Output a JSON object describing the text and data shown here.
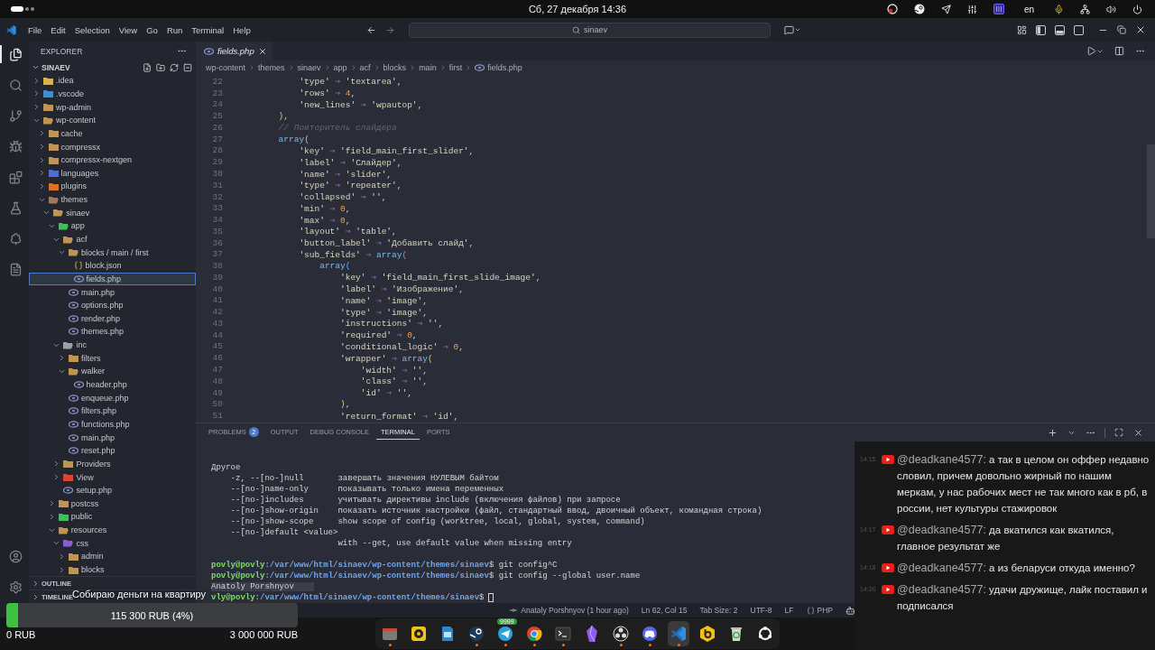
{
  "top_bar": {
    "date": "Сб, 27 декабря 14:36",
    "keyboard_layout": "en"
  },
  "title_bar": {
    "menu": [
      "File",
      "Edit",
      "Selection",
      "View",
      "Go",
      "Run",
      "Terminal",
      "Help"
    ],
    "command_center": "sinaev",
    "layout_toggles": [
      {
        "on": true
      },
      {
        "on": true
      },
      {
        "on": false
      }
    ]
  },
  "activity_bar": [
    {
      "selected": true
    },
    {
      "selected": false
    },
    {
      "selected": false
    },
    {
      "selected": false
    },
    {
      "selected": false
    },
    {
      "selected": false
    },
    {
      "selected": false
    },
    {
      "selected": false
    }
  ],
  "explorer": {
    "title": "EXPLORER",
    "root": {
      "label": "SINAEV",
      "expanded": true
    },
    "tree": [
      {
        "label": ".idea",
        "kind": "folder",
        "color": "#d8b24a",
        "expanded": false,
        "selected": false
      },
      {
        "label": ".vscode",
        "kind": "folder",
        "color": "#3d8fd1",
        "expanded": false,
        "selected": false
      },
      {
        "label": "wp-admin",
        "kind": "folder",
        "color": "#c09553",
        "expanded": false,
        "selected": false
      },
      {
        "label": "wp-content",
        "kind": "folder",
        "color": "#c09553",
        "expanded": true,
        "selected": false,
        "children": [
          {
            "label": "cache",
            "kind": "folder",
            "color": "#c09553",
            "expanded": false,
            "selected": false
          },
          {
            "label": "compressx",
            "kind": "folder",
            "color": "#c09553",
            "expanded": false,
            "selected": false
          },
          {
            "label": "compressx-nextgen",
            "kind": "folder",
            "color": "#c09553",
            "expanded": false,
            "selected": false
          },
          {
            "label": "languages",
            "kind": "folder",
            "color": "#4a6fd6",
            "expanded": false,
            "selected": false
          },
          {
            "label": "plugins",
            "kind": "folder",
            "color": "#e0701f",
            "expanded": false,
            "selected": false
          },
          {
            "label": "themes",
            "kind": "folder",
            "color": "#a0785a",
            "expanded": true,
            "selected": false,
            "children": [
              {
                "label": "sinaev",
                "kind": "folder",
                "color": "#c09553",
                "expanded": true,
                "selected": false,
                "children": [
                  {
                    "label": "app",
                    "kind": "folder",
                    "color": "#3dbf5a",
                    "expanded": true,
                    "selected": false,
                    "children": [
                      {
                        "label": "acf",
                        "kind": "folder",
                        "color": "#c09553",
                        "expanded": true,
                        "selected": false,
                        "children": [
                          {
                            "label": "blocks / main / first",
                            "kind": "folder",
                            "color": "#c09553",
                            "expanded": true,
                            "selected": false,
                            "children": [
                              {
                                "label": "block.json",
                                "kind": "json-file",
                                "selected": false
                              },
                              {
                                "label": "fields.php",
                                "kind": "php-file",
                                "selected": true
                              }
                            ]
                          },
                          {
                            "label": "main.php",
                            "kind": "php-file",
                            "selected": false
                          },
                          {
                            "label": "options.php",
                            "kind": "php-file",
                            "selected": false
                          },
                          {
                            "label": "render.php",
                            "kind": "php-file",
                            "selected": false
                          },
                          {
                            "label": "themes.php",
                            "kind": "php-file",
                            "selected": false
                          }
                        ]
                      },
                      {
                        "label": "inc",
                        "kind": "folder",
                        "color": "#9aa0a6",
                        "expanded": true,
                        "selected": false,
                        "children": [
                          {
                            "label": "filters",
                            "kind": "folder",
                            "color": "#c09553",
                            "expanded": false,
                            "selected": false
                          },
                          {
                            "label": "walker",
                            "kind": "folder",
                            "color": "#c09553",
                            "expanded": true,
                            "selected": false,
                            "children": [
                              {
                                "label": "header.php",
                                "kind": "php-file",
                                "selected": false
                              }
                            ]
                          },
                          {
                            "label": "enqueue.php",
                            "kind": "php-file",
                            "selected": false
                          },
                          {
                            "label": "filters.php",
                            "kind": "php-file",
                            "selected": false
                          },
                          {
                            "label": "functions.php",
                            "kind": "php-file",
                            "selected": false
                          },
                          {
                            "label": "main.php",
                            "kind": "php-file",
                            "selected": false
                          },
                          {
                            "label": "reset.php",
                            "kind": "php-file",
                            "selected": false
                          }
                        ]
                      },
                      {
                        "label": "Providers",
                        "kind": "folder",
                        "color": "#c09553",
                        "expanded": false,
                        "selected": false
                      },
                      {
                        "label": "View",
                        "kind": "folder",
                        "color": "#d9452f",
                        "expanded": false,
                        "selected": false
                      },
                      {
                        "label": "setup.php",
                        "kind": "php-file",
                        "selected": false
                      }
                    ]
                  },
                  {
                    "label": "postcss",
                    "kind": "folder",
                    "color": "#c09553",
                    "expanded": false,
                    "selected": false
                  },
                  {
                    "label": "public",
                    "kind": "folder",
                    "color": "#3dbf5a",
                    "expanded": false,
                    "selected": false
                  },
                  {
                    "label": "resources",
                    "kind": "folder",
                    "color": "#c09553",
                    "expanded": true,
                    "selected": false,
                    "children": [
                      {
                        "label": "css",
                        "kind": "folder",
                        "color": "#8e5bd6",
                        "expanded": true,
                        "selected": false,
                        "children": [
                          {
                            "label": "admin",
                            "kind": "folder",
                            "color": "#c09553",
                            "expanded": false,
                            "selected": false
                          },
                          {
                            "label": "blocks",
                            "kind": "folder",
                            "color": "#c09553",
                            "expanded": false,
                            "selected": false
                          }
                        ]
                      }
                    ]
                  }
                ]
              }
            ]
          }
        ]
      }
    ],
    "sections": [
      {
        "label": "OUTLINE",
        "expanded": false
      },
      {
        "label": "TIMELINE",
        "expanded": false
      }
    ]
  },
  "editor": {
    "tabs": [
      {
        "label": "fields.php",
        "selected": true,
        "preview": true
      }
    ],
    "breadcrumb": [
      "wp-content",
      "themes",
      "sinaev",
      "app",
      "acf",
      "blocks",
      "main",
      "first",
      "fields.php"
    ],
    "code": [
      {
        "number": "22",
        "tokens": [
          {
            "kind": "string",
            "text": "            'type'"
          },
          {
            "kind": "operator",
            "text": " ⇒ "
          },
          {
            "kind": "string",
            "text": "'textarea'"
          },
          {
            "kind": "punctuation",
            "text": ","
          }
        ]
      },
      {
        "number": "23",
        "tokens": [
          {
            "kind": "string",
            "text": "            'rows'"
          },
          {
            "kind": "operator",
            "text": " ⇒ "
          },
          {
            "kind": "number",
            "text": "4"
          },
          {
            "kind": "punctuation",
            "text": ","
          }
        ]
      },
      {
        "number": "24",
        "tokens": [
          {
            "kind": "string",
            "text": "            'new_lines'"
          },
          {
            "kind": "operator",
            "text": " ⇒ "
          },
          {
            "kind": "string",
            "text": "'wpautop'"
          },
          {
            "kind": "punctuation",
            "text": ","
          }
        ]
      },
      {
        "number": "25",
        "tokens": [
          {
            "kind": "bracket1",
            "text": "        )"
          },
          {
            "kind": "punctuation",
            "text": ","
          }
        ]
      },
      {
        "number": "26",
        "tokens": [
          {
            "kind": "comment",
            "text": "        // Повторитель слайдера"
          }
        ]
      },
      {
        "number": "27",
        "tokens": [
          {
            "kind": "function",
            "text": "        array"
          },
          {
            "kind": "bracket1",
            "text": "("
          }
        ]
      },
      {
        "number": "28",
        "tokens": [
          {
            "kind": "string",
            "text": "            'key'"
          },
          {
            "kind": "operator",
            "text": " ⇒ "
          },
          {
            "kind": "string",
            "text": "'field_main_first_slider'"
          },
          {
            "kind": "punctuation",
            "text": ","
          }
        ]
      },
      {
        "number": "29",
        "tokens": [
          {
            "kind": "string",
            "text": "            'label'"
          },
          {
            "kind": "operator",
            "text": " ⇒ "
          },
          {
            "kind": "string",
            "text": "'Слайдер'"
          },
          {
            "kind": "punctuation",
            "text": ","
          }
        ]
      },
      {
        "number": "30",
        "tokens": [
          {
            "kind": "string",
            "text": "            'name'"
          },
          {
            "kind": "operator",
            "text": " ⇒ "
          },
          {
            "kind": "string",
            "text": "'slider'"
          },
          {
            "kind": "punctuation",
            "text": ","
          }
        ]
      },
      {
        "number": "31",
        "tokens": [
          {
            "kind": "string",
            "text": "            'type'"
          },
          {
            "kind": "operator",
            "text": " ⇒ "
          },
          {
            "kind": "string",
            "text": "'repeater'"
          },
          {
            "kind": "punctuation",
            "text": ","
          }
        ]
      },
      {
        "number": "32",
        "tokens": [
          {
            "kind": "string",
            "text": "            'collapsed'"
          },
          {
            "kind": "operator",
            "text": " ⇒ "
          },
          {
            "kind": "string",
            "text": "''"
          },
          {
            "kind": "punctuation",
            "text": ","
          }
        ]
      },
      {
        "number": "33",
        "tokens": [
          {
            "kind": "string",
            "text": "            'min'"
          },
          {
            "kind": "operator",
            "text": " ⇒ "
          },
          {
            "kind": "number",
            "text": "0"
          },
          {
            "kind": "punctuation",
            "text": ","
          }
        ]
      },
      {
        "number": "34",
        "tokens": [
          {
            "kind": "string",
            "text": "            'max'"
          },
          {
            "kind": "operator",
            "text": " ⇒ "
          },
          {
            "kind": "number",
            "text": "0"
          },
          {
            "kind": "punctuation",
            "text": ","
          }
        ]
      },
      {
        "number": "35",
        "tokens": [
          {
            "kind": "string",
            "text": "            'layout'"
          },
          {
            "kind": "operator",
            "text": " ⇒ "
          },
          {
            "kind": "string",
            "text": "'table'"
          },
          {
            "kind": "punctuation",
            "text": ","
          }
        ]
      },
      {
        "number": "36",
        "tokens": [
          {
            "kind": "string",
            "text": "            'button_label'"
          },
          {
            "kind": "operator",
            "text": " ⇒ "
          },
          {
            "kind": "string",
            "text": "'Добавить слайд'"
          },
          {
            "kind": "punctuation",
            "text": ","
          }
        ]
      },
      {
        "number": "37",
        "tokens": [
          {
            "kind": "string",
            "text": "            'sub_fields'"
          },
          {
            "kind": "operator",
            "text": " ⇒ "
          },
          {
            "kind": "function",
            "text": "array"
          },
          {
            "kind": "bracket2",
            "text": "("
          }
        ]
      },
      {
        "number": "38",
        "tokens": [
          {
            "kind": "function",
            "text": "                array"
          },
          {
            "kind": "bracket3",
            "text": "("
          }
        ]
      },
      {
        "number": "39",
        "tokens": [
          {
            "kind": "string",
            "text": "                    'key'"
          },
          {
            "kind": "operator",
            "text": " ⇒ "
          },
          {
            "kind": "string",
            "text": "'field_main_first_slide_image'"
          },
          {
            "kind": "punctuation",
            "text": ","
          }
        ]
      },
      {
        "number": "40",
        "tokens": [
          {
            "kind": "string",
            "text": "                    'label'"
          },
          {
            "kind": "operator",
            "text": " ⇒ "
          },
          {
            "kind": "string",
            "text": "'Изображение'"
          },
          {
            "kind": "punctuation",
            "text": ","
          }
        ]
      },
      {
        "number": "41",
        "tokens": [
          {
            "kind": "string",
            "text": "                    'name'"
          },
          {
            "kind": "operator",
            "text": " ⇒ "
          },
          {
            "kind": "string",
            "text": "'image'"
          },
          {
            "kind": "punctuation",
            "text": ","
          }
        ]
      },
      {
        "number": "42",
        "tokens": [
          {
            "kind": "string",
            "text": "                    'type'"
          },
          {
            "kind": "operator",
            "text": " ⇒ "
          },
          {
            "kind": "string",
            "text": "'image'"
          },
          {
            "kind": "punctuation",
            "text": ","
          }
        ]
      },
      {
        "number": "43",
        "tokens": [
          {
            "kind": "string",
            "text": "                    'instructions'"
          },
          {
            "kind": "operator",
            "text": " ⇒ "
          },
          {
            "kind": "string",
            "text": "''"
          },
          {
            "kind": "punctuation",
            "text": ","
          }
        ]
      },
      {
        "number": "44",
        "tokens": [
          {
            "kind": "string",
            "text": "                    'required'"
          },
          {
            "kind": "operator",
            "text": " ⇒ "
          },
          {
            "kind": "number",
            "text": "0"
          },
          {
            "kind": "punctuation",
            "text": ","
          }
        ]
      },
      {
        "number": "45",
        "tokens": [
          {
            "kind": "string",
            "text": "                    'conditional_logic'"
          },
          {
            "kind": "operator",
            "text": " ⇒ "
          },
          {
            "kind": "number",
            "text": "0"
          },
          {
            "kind": "punctuation",
            "text": ","
          }
        ]
      },
      {
        "number": "46",
        "tokens": [
          {
            "kind": "string",
            "text": "                    'wrapper'"
          },
          {
            "kind": "operator",
            "text": " ⇒ "
          },
          {
            "kind": "function",
            "text": "array"
          },
          {
            "kind": "bracket1",
            "text": "("
          }
        ]
      },
      {
        "number": "47",
        "tokens": [
          {
            "kind": "string",
            "text": "                        'width'"
          },
          {
            "kind": "operator",
            "text": " ⇒ "
          },
          {
            "kind": "string",
            "text": "''"
          },
          {
            "kind": "punctuation",
            "text": ","
          }
        ]
      },
      {
        "number": "48",
        "tokens": [
          {
            "kind": "string",
            "text": "                        'class'"
          },
          {
            "kind": "operator",
            "text": " ⇒ "
          },
          {
            "kind": "string",
            "text": "''"
          },
          {
            "kind": "punctuation",
            "text": ","
          }
        ]
      },
      {
        "number": "49",
        "tokens": [
          {
            "kind": "string",
            "text": "                        'id'"
          },
          {
            "kind": "operator",
            "text": " ⇒ "
          },
          {
            "kind": "string",
            "text": "''"
          },
          {
            "kind": "punctuation",
            "text": ","
          }
        ]
      },
      {
        "number": "50",
        "tokens": [
          {
            "kind": "bracket1",
            "text": "                    )"
          },
          {
            "kind": "punctuation",
            "text": ","
          }
        ]
      },
      {
        "number": "51",
        "tokens": [
          {
            "kind": "string",
            "text": "                    'return_format'"
          },
          {
            "kind": "operator",
            "text": " ⇒ "
          },
          {
            "kind": "string",
            "text": "'id'"
          },
          {
            "kind": "punctuation",
            "text": ","
          }
        ]
      }
    ]
  },
  "panel": {
    "tabs": [
      {
        "label": "PROBLEMS",
        "badge": "2",
        "selected": false
      },
      {
        "label": "OUTPUT",
        "selected": false
      },
      {
        "label": "DEBUG CONSOLE",
        "selected": false
      },
      {
        "label": "TERMINAL",
        "selected": true
      },
      {
        "label": "PORTS",
        "selected": false
      }
    ],
    "terminal": [
      {
        "kind": "output",
        "text": "Другое",
        "highlighted": false
      },
      {
        "kind": "output",
        "text": "    -z, --[no-]null       завершать значения НУЛЕВЫМ байтом",
        "highlighted": false
      },
      {
        "kind": "output",
        "text": "    --[no-]name-only      показывать только имена переменных",
        "highlighted": false
      },
      {
        "kind": "output",
        "text": "    --[no-]includes       учитывать директивы include (включения файлов) при запросе",
        "highlighted": false
      },
      {
        "kind": "output",
        "text": "    --[no-]show-origin    показать источник настройки (файл, стандартный ввод, двоичный объект, командная строка)",
        "highlighted": false
      },
      {
        "kind": "output",
        "text": "    --[no-]show-scope     show scope of config (worktree, local, global, system, command)",
        "highlighted": false
      },
      {
        "kind": "output",
        "text": "    --[no-]default <value>",
        "highlighted": false
      },
      {
        "kind": "output",
        "text": "                          with --get, use default value when missing entry",
        "highlighted": false
      },
      {
        "kind": "prompt",
        "user": "povly@povly",
        "path": ":/var/www/html/sinaev/wp-content/themes/sinaev",
        "command": "$ git config^C",
        "highlighted": false
      },
      {
        "kind": "prompt",
        "user": "povly@povly",
        "path": ":/var/www/html/sinaev/wp-content/themes/sinaev",
        "command": "$ git config --global user.name",
        "highlighted": false
      },
      {
        "kind": "output",
        "text": "Anatoly Porshnyov",
        "highlighted": true
      },
      {
        "kind": "prompt",
        "user": "vly@povly",
        "path": ":/var/www/html/sinaev/wp-content/themes/sinaev",
        "command": "$",
        "highlighted": false
      }
    ]
  },
  "status_bar": [
    {
      "kind": "blame",
      "text": "Anataly Porshnyov (1 hour ago)"
    },
    {
      "kind": "text",
      "text": "Ln 62, Col 15"
    },
    {
      "kind": "text",
      "text": "Tab Size: 2"
    },
    {
      "kind": "text",
      "text": "UTF-8"
    },
    {
      "kind": "text",
      "text": "LF"
    },
    {
      "kind": "language",
      "text": "PHP"
    },
    {
      "kind": "copilot"
    }
  ],
  "dock": [
    {
      "running": true,
      "active": false
    },
    {
      "running": false,
      "active": false
    },
    {
      "running": false,
      "active": false
    },
    {
      "running": true,
      "active": false
    },
    {
      "running": true,
      "active": false,
      "badge": "9999"
    },
    {
      "running": true,
      "active": false
    },
    {
      "running": true,
      "active": false
    },
    {
      "running": false,
      "active": false
    },
    {
      "running": true,
      "active": false
    },
    {
      "running": true,
      "active": false
    },
    {
      "running": true,
      "active": true
    },
    {
      "running": false,
      "active": false
    },
    {
      "running": false,
      "active": false
    },
    {
      "running": false,
      "active": false
    }
  ],
  "donation": {
    "title": "Собираю деньги на квартиру",
    "amount": "115 300 RUB (4%)",
    "level": 0.04,
    "min": "0 RUB",
    "goal": "3 000 000 RUB"
  },
  "chat": [
    {
      "time": "14:15",
      "author": "@deadkane4577:",
      "text": "а так в целом он оффер недавно словил, причем довольно жирный по нашим меркам, у нас рабочих мест не так много как в рб, в россии, нет культуры стажировок"
    },
    {
      "time": "14:17",
      "author": "@deadkane4577:",
      "text": "да вкатился как вкатился, главное результат же"
    },
    {
      "time": "14:18",
      "author": "@deadkane4577:",
      "text": "а из беларуси откуда именно?"
    },
    {
      "time": "14:20",
      "author": "@deadkane4577:",
      "text": "удачи дружище, лайк поставил и подписался"
    }
  ]
}
